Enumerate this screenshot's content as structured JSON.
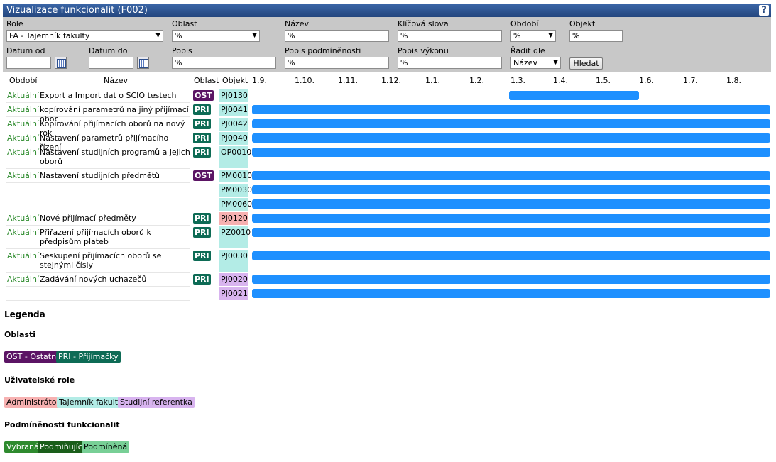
{
  "title": "Vizualizace funkcionalit (F002)",
  "help_label": "?",
  "filters": {
    "role": {
      "label": "Role",
      "value": "FA - Tajemník fakulty"
    },
    "oblast": {
      "label": "Oblast",
      "value": "%"
    },
    "nazev": {
      "label": "Název",
      "value": "%"
    },
    "klicova_slova": {
      "label": "Klíčová slova",
      "value": "%"
    },
    "obdobi": {
      "label": "Období",
      "value": "%"
    },
    "objekt": {
      "label": "Objekt",
      "value": "%"
    },
    "datum_od": {
      "label": "Datum od",
      "value": ""
    },
    "datum_do": {
      "label": "Datum do",
      "value": ""
    },
    "popis": {
      "label": "Popis",
      "value": "%"
    },
    "popis_podminenosti": {
      "label": "Popis podmíněnosti",
      "value": "%"
    },
    "popis_vykonu": {
      "label": "Popis výkonu",
      "value": "%"
    },
    "radit_dle": {
      "label": "Řadit dle",
      "value": "Název"
    },
    "search_label": "Hledat"
  },
  "table": {
    "headers": {
      "obdobi": "Období",
      "nazev": "Název",
      "oblast": "Oblast",
      "objekt": "Objekt"
    },
    "months": [
      "1.9.",
      "1.10.",
      "1.11.",
      "1.12.",
      "1.1.",
      "1.2.",
      "1.3.",
      "1.4.",
      "1.5.",
      "1.6.",
      "1.7.",
      "1.8."
    ],
    "rows": [
      {
        "period": "Aktuální",
        "name": "Export a Import dat o SCIO testech",
        "area": "OST",
        "object": "PJ0130"
      },
      {
        "period": "Aktuální",
        "name": "kopírování parametrů na jiný přijímací obor",
        "area": "PRI",
        "object": "PJ0041"
      },
      {
        "period": "Aktuální",
        "name": "Kopírování přijímacích oborů na nový rok",
        "area": "PRI",
        "object": "PJ0042"
      },
      {
        "period": "Aktuální",
        "name": "Nastavení parametrů přijímacího řízení",
        "area": "PRI",
        "object": "PJ0040"
      },
      {
        "period": "Aktuální",
        "name": "Nastavení studijních programů a jejich oborů",
        "area": "PRI",
        "object": "OP0010"
      },
      {
        "period": "Aktuální",
        "name": "Nastavení studijních předmětů",
        "area": "OST",
        "object": "PM0010"
      },
      {
        "period": "",
        "name": "",
        "area": "",
        "object": "PM0030"
      },
      {
        "period": "",
        "name": "",
        "area": "",
        "object": "PM0060"
      },
      {
        "period": "Aktuální",
        "name": "Nové přijímací předměty",
        "area": "PRI",
        "object": "PJ0120"
      },
      {
        "period": "Aktuální",
        "name": "Přiřazení přijímacích oborů k předpisům plateb",
        "area": "PRI",
        "object": "PZ0010"
      },
      {
        "period": "Aktuální",
        "name": "Seskupení přijímacích oborů se stejnými čísly",
        "area": "PRI",
        "object": "PJ0030"
      },
      {
        "period": "Aktuální",
        "name": "Zadávání nových uchazečů",
        "area": "PRI",
        "object": "PJ0020"
      },
      {
        "period": "",
        "name": "",
        "area": "",
        "object": "PJ0021"
      }
    ]
  },
  "legend": {
    "title": "Legenda",
    "areas_title": "Oblasti",
    "areas": [
      "OST - Ostatní",
      "PRI - Přijímačky"
    ],
    "roles_title": "Uživatelské role",
    "roles": [
      "Administrátor",
      "Tajemník fakulty",
      "Studijní referentka"
    ],
    "conditions_title": "Podmíněnosti funkcionalit",
    "conditions": [
      "Vybraná",
      "Podmiňující",
      "Podmíněná"
    ]
  },
  "colors": {
    "ost": "#5b1464",
    "pri": "#0d6b55",
    "bar": "#1e90ff",
    "admin": "#f7b1b1",
    "tajemnik": "#b3ece6",
    "referentka": "#d8b4ef",
    "vybrana": "#2e8a2e",
    "podminujici": "#1a5e1a",
    "podminena": "#78cf96"
  }
}
